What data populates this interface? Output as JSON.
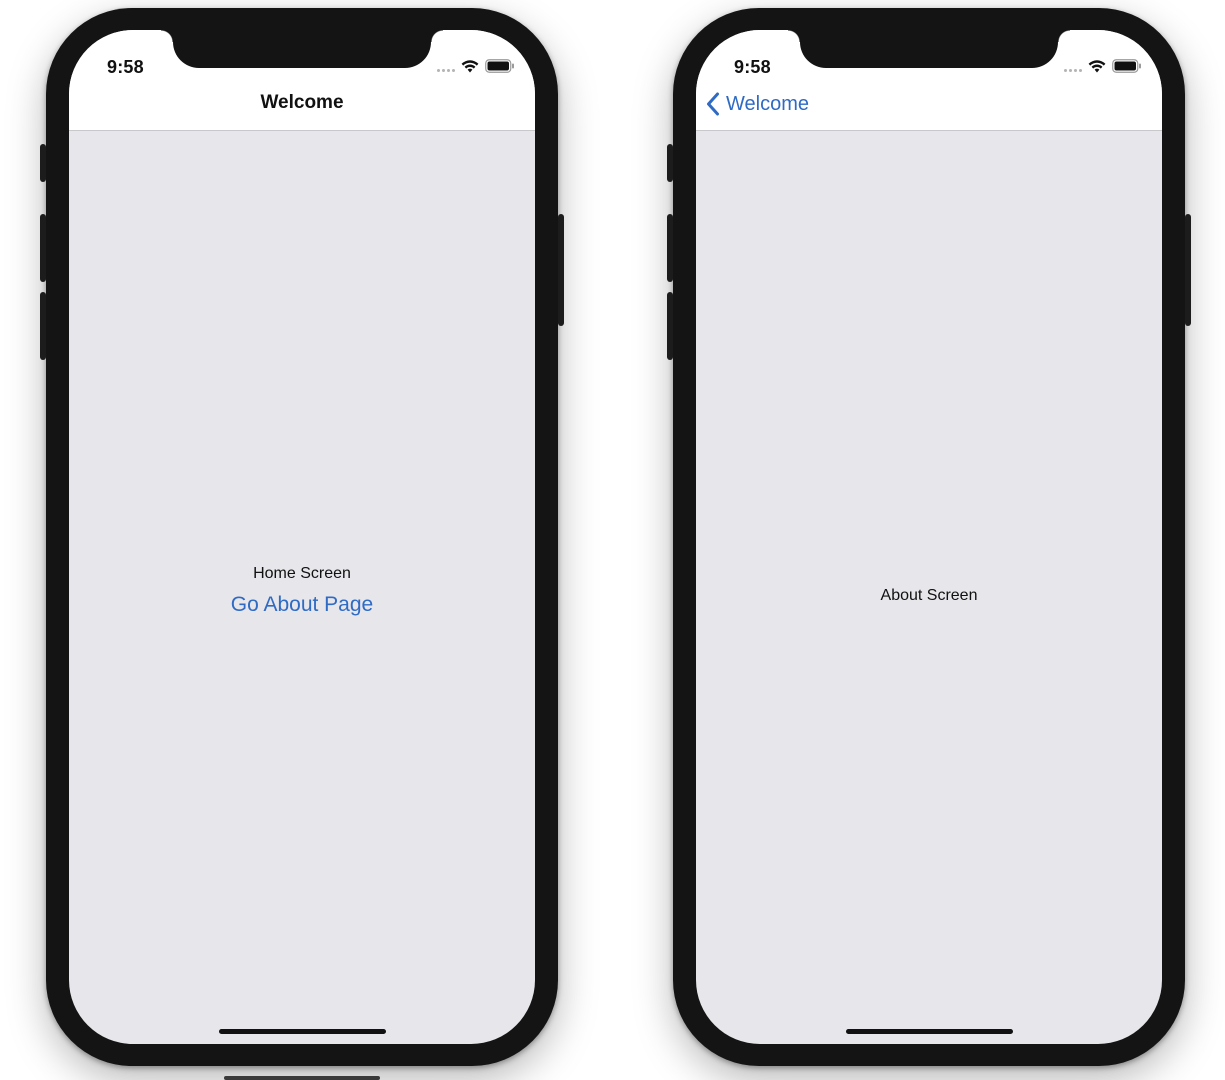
{
  "left_phone": {
    "status": {
      "time": "9:58"
    },
    "navbar": {
      "title": "Welcome"
    },
    "content": {
      "label": "Home Screen",
      "link": "Go About Page"
    }
  },
  "right_phone": {
    "status": {
      "time": "9:58"
    },
    "navbar": {
      "back_label": "Welcome"
    },
    "content": {
      "label": "About Screen"
    }
  },
  "colors": {
    "accent": "#2f6bc4",
    "screen_background": "#e6e6eb",
    "navbar_background": "#ffffff",
    "device_frame": "#141414"
  },
  "icons": [
    "wifi-icon",
    "battery-icon",
    "signal-icon",
    "back-chevron-icon"
  ]
}
